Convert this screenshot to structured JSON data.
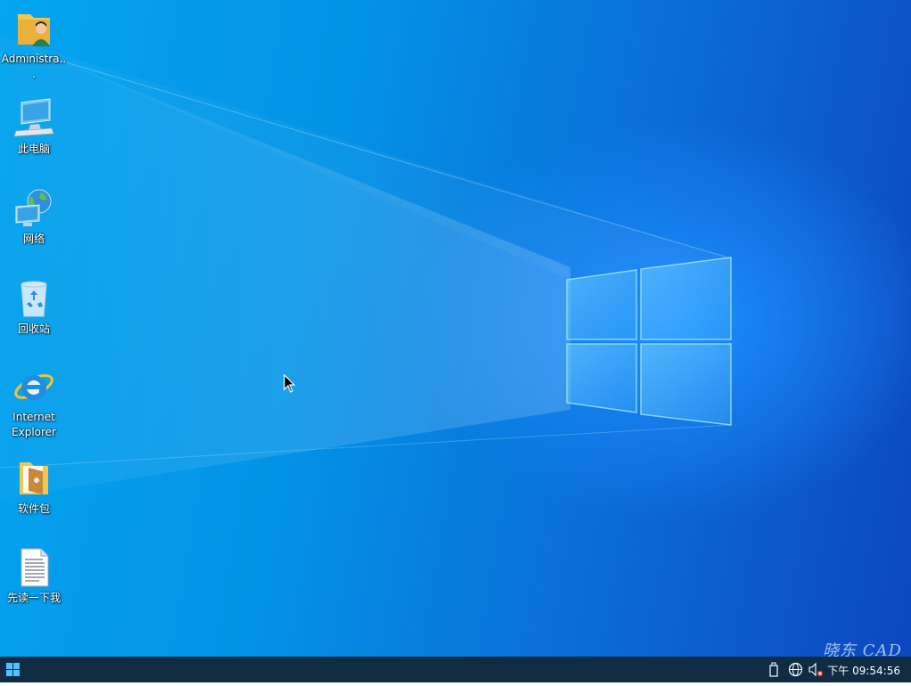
{
  "desktop": {
    "icons": [
      {
        "label": "Administra..."
      },
      {
        "label": "此电脑"
      },
      {
        "label": "网络"
      },
      {
        "label": "回收站"
      },
      {
        "label": "Internet Explorer"
      },
      {
        "label": "软件包"
      },
      {
        "label": "先读一下我"
      }
    ]
  },
  "taskbar": {
    "clock": "下午 09:54:56",
    "start_icon": "windows-start-icon",
    "tray_icons": [
      "usb-drive-icon",
      "network-globe-icon",
      "volume-muted-icon"
    ]
  },
  "watermark": "晓东 CAD",
  "colors": {
    "taskbar": "#0f2c42",
    "wallpaper_light": "#05a5ef",
    "wallpaper_dark": "#0d47bf"
  }
}
